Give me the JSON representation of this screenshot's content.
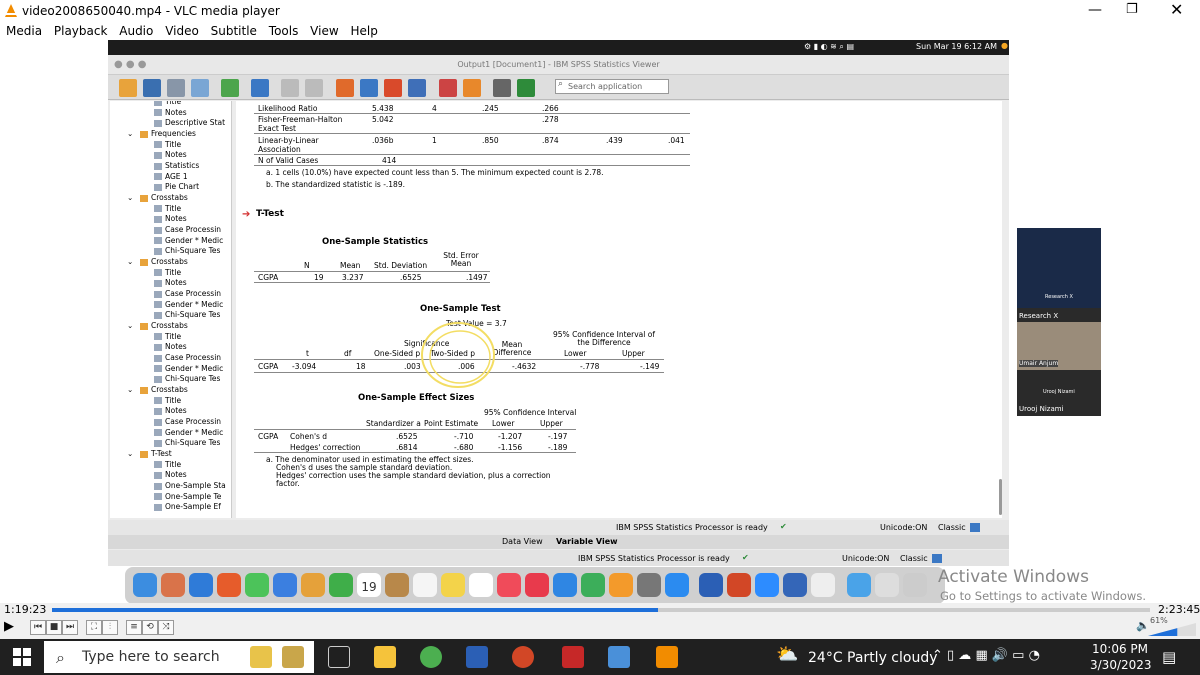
{
  "vlc": {
    "title": "video2008650040.mp4 - VLC media player",
    "menu": [
      "Media",
      "Playback",
      "Audio",
      "Video",
      "Subtitle",
      "Tools",
      "View",
      "Help"
    ],
    "time_elapsed": "1:19:23",
    "time_total": "2:23:45",
    "progress_fraction": 0.552,
    "volume": "61%",
    "volume_fraction": 0.61
  },
  "mac": {
    "clock": "Sun Mar 19  6:12 AM"
  },
  "spss": {
    "window_title": "Output1 [Document1] - IBM SPSS Statistics Viewer",
    "search_placeholder": "Search application",
    "nav": [
      {
        "label": "Title",
        "level": 2
      },
      {
        "label": "Notes",
        "level": 2
      },
      {
        "label": "Descriptive Stat",
        "level": 2
      },
      {
        "label": "Frequencies",
        "level": 1
      },
      {
        "label": "Title",
        "level": 2
      },
      {
        "label": "Notes",
        "level": 2
      },
      {
        "label": "Statistics",
        "level": 2
      },
      {
        "label": "AGE 1",
        "level": 2
      },
      {
        "label": "Pie Chart",
        "level": 2
      },
      {
        "label": "Crosstabs",
        "level": 1
      },
      {
        "label": "Title",
        "level": 2
      },
      {
        "label": "Notes",
        "level": 2
      },
      {
        "label": "Case Processin",
        "level": 2
      },
      {
        "label": "Gender * Medic",
        "level": 2
      },
      {
        "label": "Chi-Square Tes",
        "level": 2
      },
      {
        "label": "Crosstabs",
        "level": 1
      },
      {
        "label": "Title",
        "level": 2
      },
      {
        "label": "Notes",
        "level": 2
      },
      {
        "label": "Case Processin",
        "level": 2
      },
      {
        "label": "Gender * Medic",
        "level": 2
      },
      {
        "label": "Chi-Square Tes",
        "level": 2
      },
      {
        "label": "Crosstabs",
        "level": 1
      },
      {
        "label": "Title",
        "level": 2
      },
      {
        "label": "Notes",
        "level": 2
      },
      {
        "label": "Case Processin",
        "level": 2
      },
      {
        "label": "Gender * Medic",
        "level": 2
      },
      {
        "label": "Chi-Square Tes",
        "level": 2
      },
      {
        "label": "Crosstabs",
        "level": 1
      },
      {
        "label": "Title",
        "level": 2
      },
      {
        "label": "Notes",
        "level": 2
      },
      {
        "label": "Case Processin",
        "level": 2
      },
      {
        "label": "Gender * Medic",
        "level": 2
      },
      {
        "label": "Chi-Square Tes",
        "level": 2
      },
      {
        "label": "T-Test",
        "level": 1
      },
      {
        "label": "Title",
        "level": 2
      },
      {
        "label": "Notes",
        "level": 2
      },
      {
        "label": "One-Sample Sta",
        "level": 2
      },
      {
        "label": "One-Sample Te",
        "level": 2
      },
      {
        "label": "One-Sample Ef",
        "level": 2
      }
    ],
    "chisq": {
      "rows": [
        [
          "Likelihood Ratio",
          "5.438",
          "4",
          ".245",
          ".266",
          "",
          ""
        ],
        [
          "Fisher-Freeman-Halton Exact Test",
          "5.042",
          "",
          "",
          ".278",
          "",
          ""
        ],
        [
          "Linear-by-Linear Association",
          ".036b",
          "1",
          ".850",
          ".874",
          ".439",
          ".041"
        ],
        [
          "N of Valid Cases",
          "414",
          "",
          "",
          "",
          "",
          ""
        ]
      ],
      "footnote_a": "a. 1 cells (10.0%) have expected count less than 5. The minimum expected count is 2.78.",
      "footnote_b": "b. The standardized statistic is -.189."
    },
    "ttest_heading": "T-Test",
    "stats_table": {
      "title": "One-Sample Statistics",
      "headers": [
        "N",
        "Mean",
        "Std. Deviation",
        "Std. Error Mean"
      ],
      "row_label": "CGPA",
      "row": [
        "19",
        "3.237",
        ".6525",
        ".1497"
      ]
    },
    "test_table": {
      "title": "One-Sample Test",
      "test_value": "Test Value = 3.7",
      "significance": "Significance",
      "ci_header": "95% Confidence Interval of the Difference",
      "headers": [
        "t",
        "df",
        "One-Sided p",
        "Two-Sided p",
        "Mean Difference",
        "Lower",
        "Upper"
      ],
      "row_label": "CGPA",
      "row": [
        "-3.094",
        "18",
        ".003",
        ".006",
        "-.4632",
        "-.778",
        "-.149"
      ]
    },
    "effect_table": {
      "title": "One-Sample Effect Sizes",
      "ci_header": "95% Confidence Interval",
      "headers": [
        "Standardizer a",
        "Point Estimate",
        "Lower",
        "Upper"
      ],
      "group_label": "CGPA",
      "rows": [
        {
          "label": "Cohen's d",
          "values": [
            ".6525",
            "-.710",
            "-1.207",
            "-.197"
          ]
        },
        {
          "label": "Hedges' correction",
          "values": [
            ".6814",
            "-.680",
            "-1.156",
            "-.189"
          ]
        }
      ],
      "footnote": "a. The denominator used in estimating the effect sizes.",
      "footnote2": "Cohen's d uses the sample standard deviation.",
      "footnote3": "Hedges' correction uses the sample standard deviation, plus a correction",
      "footnote4": "factor."
    },
    "status_ready": "IBM SPSS Statistics Processor is ready",
    "unicode": "Unicode:ON",
    "classic": "Classic",
    "tab_data": "Data View",
    "tab_variable": "Variable View"
  },
  "webcam": {
    "name1": "Research X",
    "name1b": "Research X",
    "name2": "Umair Anjum",
    "name3": "Urooj Nizami",
    "name3b": "Urooj Nizami"
  },
  "dock": {
    "calendar_day": "19"
  },
  "activate": {
    "line1": "Activate Windows",
    "line2": "Go to Settings to activate Windows."
  },
  "taskbar": {
    "search_placeholder": "Type here to search",
    "weather": "24°C  Partly cloudy",
    "time": "10:06 PM",
    "date": "3/30/2023"
  },
  "colors": {
    "accent_blue": "#1e6fd9",
    "taskbar": "#202020",
    "arrow_red": "#d32f2f"
  }
}
